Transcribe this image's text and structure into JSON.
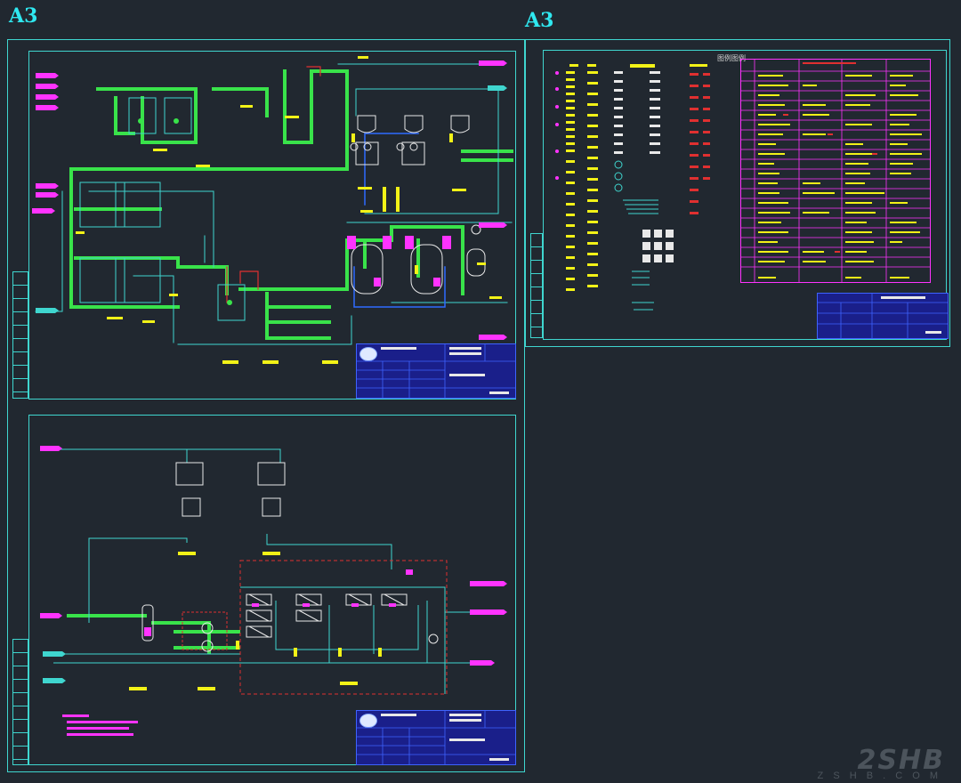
{
  "sheets": {
    "left_label": "A3",
    "right_label": "A3"
  },
  "legend": {
    "title": "图例图例"
  },
  "watermark": {
    "text": "2SHB",
    "sub": "Z S H B . C O M"
  },
  "colors": {
    "background": "#212830",
    "frame": "#3fd6cf",
    "main_pipe": "#39e34a",
    "yellow_tag": "#f2f217",
    "magenta": "#ff33ff",
    "title_block": "#1a1f8a",
    "red": "#e03030"
  },
  "icons": [
    "company-logo-icon",
    "tank-icon",
    "pump-icon",
    "valve-icon",
    "heat-exchanger-icon",
    "instrument-bubble-icon"
  ]
}
